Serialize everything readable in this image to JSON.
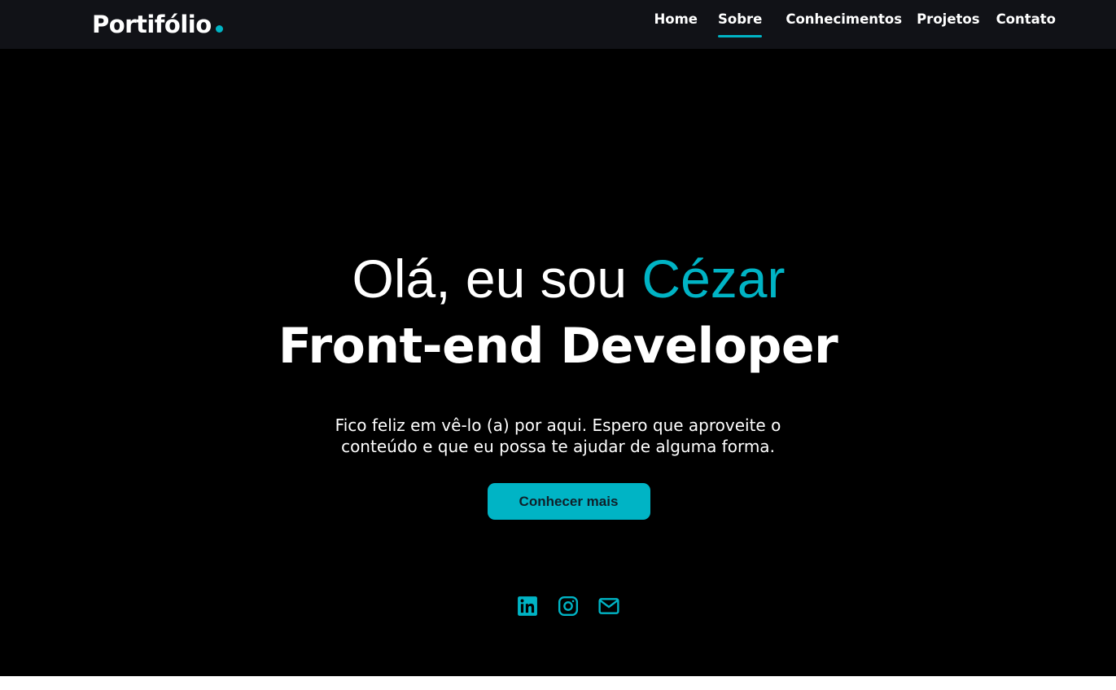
{
  "colors": {
    "accent": "#00b4c5",
    "navbar_bg": "#111217",
    "page_bg": "#000000",
    "text": "#ffffff",
    "button_text": "#10202a"
  },
  "logo": {
    "text": "Portifólio"
  },
  "nav": {
    "items": [
      {
        "label": "Home",
        "active": false
      },
      {
        "label": "Sobre",
        "active": true
      },
      {
        "label": "Conhecimentos",
        "active": false
      },
      {
        "label": "Projetos",
        "active": false
      },
      {
        "label": "Contato",
        "active": false
      }
    ]
  },
  "hero": {
    "greeting_prefix": "Olá, eu sou ",
    "greeting_name": "Cézar",
    "role": "Front-end Developer",
    "intro": "Fico feliz em vê-lo (a) por aqui. Espero que aproveite o conteúdo e que eu possa te ajudar de alguma forma.",
    "cta_label": "Conhecer mais"
  },
  "socials": [
    {
      "icon": "linkedin-icon"
    },
    {
      "icon": "instagram-icon"
    },
    {
      "icon": "mail-icon"
    }
  ]
}
